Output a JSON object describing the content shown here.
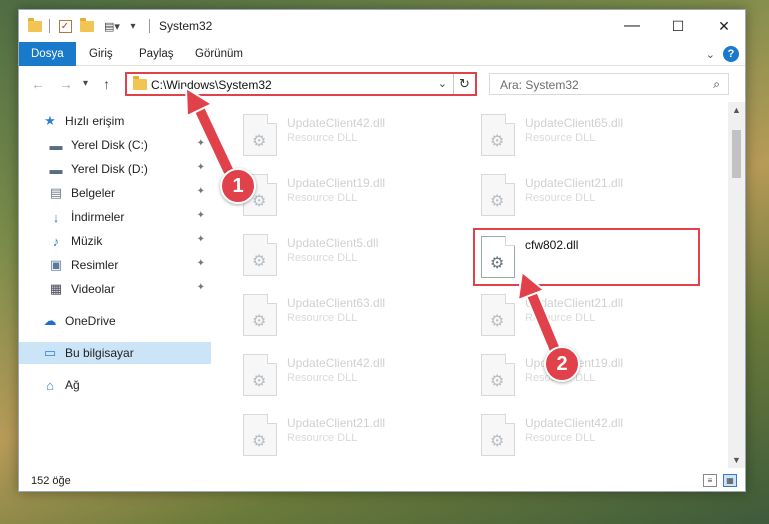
{
  "window": {
    "title": "System32",
    "minimize": "—",
    "maximize": "☐",
    "close": "✕"
  },
  "ribbon": {
    "tabs": [
      "Dosya",
      "Giriş",
      "Paylaş",
      "Görünüm"
    ]
  },
  "address": {
    "path": "C:\\Windows\\System32",
    "search_placeholder": "Ara: System32"
  },
  "sidebar": {
    "items": [
      {
        "label": "Hızlı erişim",
        "icon": "star-icon"
      },
      {
        "label": "Yerel Disk (C:)",
        "icon": "drive-icon",
        "pinned": true
      },
      {
        "label": "Yerel Disk (D:)",
        "icon": "drive-icon",
        "pinned": true
      },
      {
        "label": "Belgeler",
        "icon": "document-icon",
        "pinned": true
      },
      {
        "label": "İndirmeler",
        "icon": "download-icon",
        "pinned": true
      },
      {
        "label": "Müzik",
        "icon": "music-icon",
        "pinned": true
      },
      {
        "label": "Resimler",
        "icon": "pictures-icon",
        "pinned": true
      },
      {
        "label": "Videolar",
        "icon": "video-icon",
        "pinned": true
      },
      {
        "label": "OneDrive",
        "icon": "cloud-icon"
      },
      {
        "label": "Bu bilgisayar",
        "icon": "computer-icon",
        "selected": true
      },
      {
        "label": "Ağ",
        "icon": "network-icon"
      }
    ]
  },
  "files": {
    "left_column": [
      {
        "name": "UpdateClient42.dll",
        "type": "Resource DLL"
      },
      {
        "name": "UpdateClient19.dll",
        "type": "Resource DLL"
      },
      {
        "name": "UpdateClient5.dll",
        "type": "Resource DLL"
      },
      {
        "name": "UpdateClient63.dll",
        "type": "Resource DLL"
      },
      {
        "name": "UpdateClient42.dll",
        "type": "Resource DLL"
      },
      {
        "name": "UpdateClient21.dll",
        "type": "Resource DLL"
      }
    ],
    "right_column": [
      {
        "name": "UpdateClient65.dll",
        "type": "Resource DLL"
      },
      {
        "name": "UpdateClient21.dll",
        "type": "Resource DLL"
      },
      {
        "name": "cfw802.dll",
        "type": ""
      },
      {
        "name": "UpdateClient21.dll",
        "type": "Resource DLL"
      },
      {
        "name": "UpdateClient19.dll",
        "type": "Resource DLL"
      },
      {
        "name": "UpdateClient42.dll",
        "type": "Resource DLL"
      }
    ]
  },
  "status": {
    "item_count": "152 öğe"
  },
  "annotations": {
    "step1": "1",
    "step2": "2",
    "color": "#e0414a"
  }
}
